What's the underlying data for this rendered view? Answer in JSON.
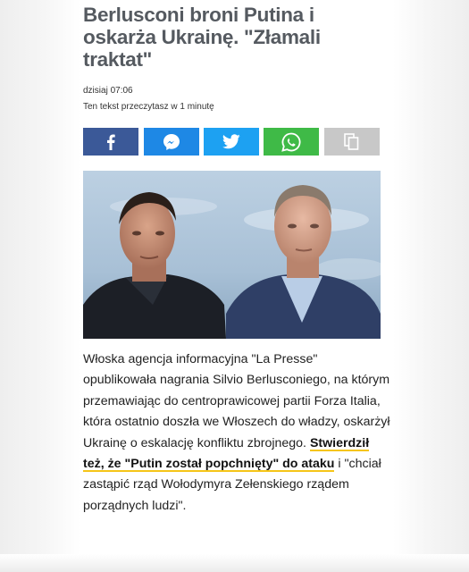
{
  "article": {
    "title": "Berlusconi broni Putina i oskarża Ukrainę. \"Złamali traktat\"",
    "time": "dzisiaj 07:06",
    "read_time": "Ten tekst przeczytasz w 1 minutę",
    "body": {
      "p1": "Włoska agencja informacyjna \"La Presse\" opublikowała nagrania Silvio Berlusconiego, na którym przemawiając do centroprawicowej partii Forza Italia, która ostatnio doszła we Włoszech do władzy, oskarżył Ukrainę o eskalację konfliktu zbrojnego. ",
      "h1": "Stwierdził też, że \"Putin został popchnięty\" do ataku",
      "p2": " i \"chciał zastąpić rząd Wołodymyra Zełenskiego rządem porządnych ludzi\"."
    }
  },
  "share": [
    {
      "name": "facebook",
      "icon": "facebook-icon",
      "color": "#3b5998"
    },
    {
      "name": "messenger",
      "icon": "messenger-icon",
      "color": "#1e88e5"
    },
    {
      "name": "twitter",
      "icon": "twitter-icon",
      "color": "#1da1f2"
    },
    {
      "name": "whatsapp",
      "icon": "whatsapp-icon",
      "color": "#3fba47"
    },
    {
      "name": "copy",
      "icon": "copy-icon",
      "color": "#c8c8c8"
    }
  ],
  "colors": {
    "title": "#555a60",
    "highlight_underline": "#f5c518"
  }
}
